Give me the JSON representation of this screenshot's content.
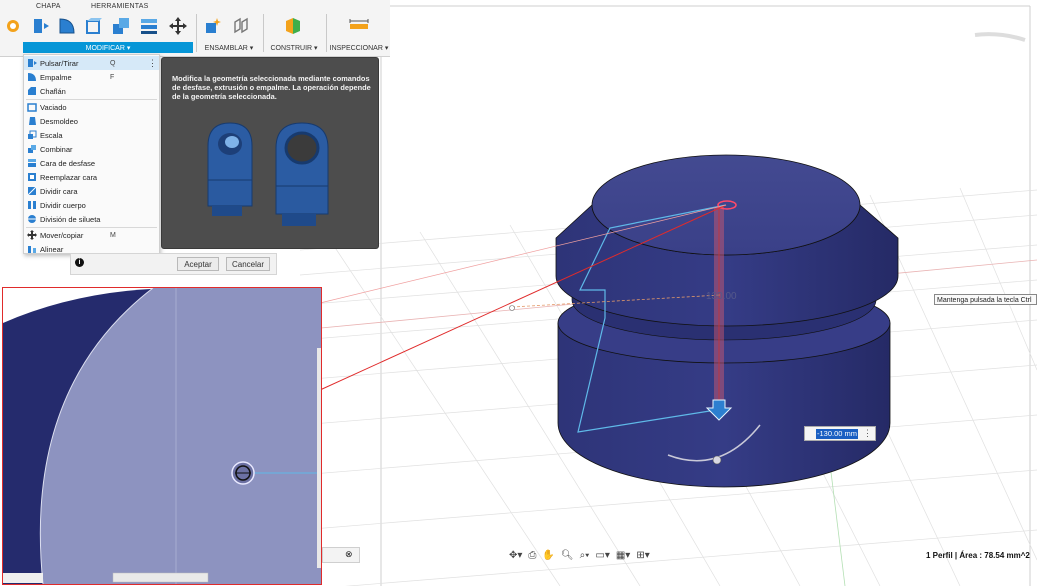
{
  "tabs": [
    "CHAPA",
    "HERRAMIENTAS"
  ],
  "toolbar": {
    "groups": [
      {
        "label": "MODIFICAR ▾",
        "active": true
      },
      {
        "label": "ENSAMBLAR ▾",
        "active": false
      },
      {
        "label": "CONSTRUIR ▾",
        "active": false
      },
      {
        "label": "INSPECCIONAR ▾",
        "active": false
      }
    ]
  },
  "menu": {
    "items": [
      {
        "label": "Pulsar/Tirar",
        "shortcut": "Q",
        "highlighted": true,
        "icon": "press-pull-icon"
      },
      {
        "label": "Empalme",
        "shortcut": "F",
        "icon": "fillet-icon"
      },
      {
        "label": "Chaflán",
        "shortcut": "",
        "icon": "chamfer-icon"
      },
      {
        "label": "Vaciado",
        "shortcut": "",
        "icon": "shell-icon"
      },
      {
        "label": "Desmoldeo",
        "shortcut": "",
        "icon": "draft-icon"
      },
      {
        "label": "Escala",
        "shortcut": "",
        "icon": "scale-icon"
      },
      {
        "label": "Combinar",
        "shortcut": "",
        "icon": "combine-icon"
      },
      {
        "label": "Cara de desfase",
        "shortcut": "",
        "icon": "offset-face-icon"
      },
      {
        "label": "Reemplazar cara",
        "shortcut": "",
        "icon": "replace-face-icon"
      },
      {
        "label": "Dividir cara",
        "shortcut": "",
        "icon": "split-face-icon"
      },
      {
        "label": "Dividir cuerpo",
        "shortcut": "",
        "icon": "split-body-icon"
      },
      {
        "label": "División de silueta",
        "shortcut": "",
        "icon": "silhouette-split-icon"
      },
      {
        "label": "Mover/copiar",
        "shortcut": "M",
        "icon": "move-icon"
      },
      {
        "label": "Alinear",
        "shortcut": "",
        "icon": "align-icon"
      }
    ]
  },
  "tooltip": {
    "text": "Modifica la geometría seleccionada mediante comandos de desfase, extrusión o empalme. La operación depende de la geometría seleccionada."
  },
  "dialog": {
    "ok_label": "Aceptar",
    "cancel_label": "Cancelar"
  },
  "viewport": {
    "dimension_label": "130.00",
    "dimension_input": "-130.00 mm",
    "hint": "Mantenga pulsada la tecla Ctrl",
    "body_color": "#2b3170",
    "accent": "#0696d7"
  },
  "status": {
    "text": "1 Perfil | Área : 78.54 mm^2"
  }
}
